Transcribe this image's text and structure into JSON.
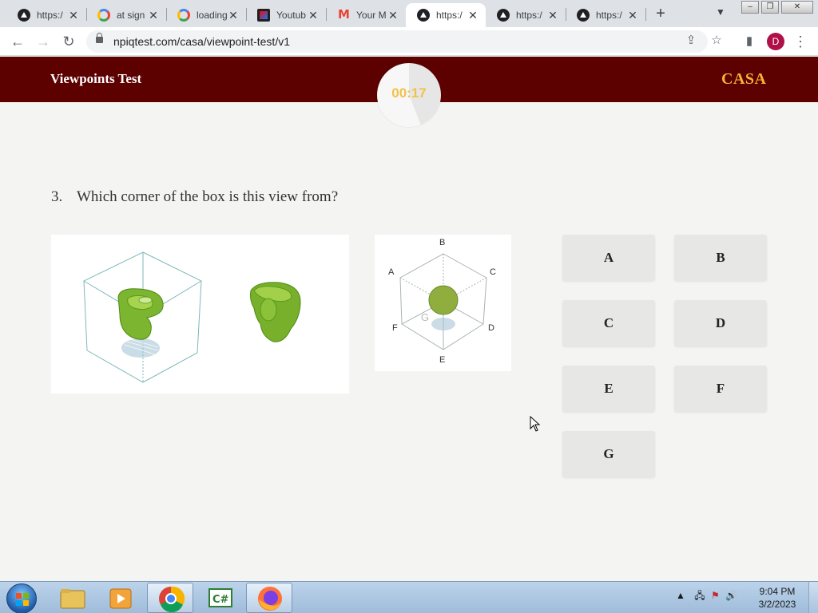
{
  "browser": {
    "tabs": [
      {
        "title": "https:/",
        "icon": "vercel-icon"
      },
      {
        "title": "at sign",
        "icon": "google-icon"
      },
      {
        "title": "loading",
        "icon": "google-icon"
      },
      {
        "title": "Youtub",
        "icon": "youtube-studio-icon"
      },
      {
        "title": "Your M",
        "icon": "gmail-icon"
      },
      {
        "title": "https:/",
        "icon": "vercel-icon",
        "active": true
      },
      {
        "title": "https:/",
        "icon": "vercel-icon"
      },
      {
        "title": "https:/",
        "icon": "vercel-icon"
      }
    ],
    "url": "npiqtest.com/casa/viewpoint-test/v1",
    "profile_initial": "D"
  },
  "site": {
    "title": "Viewpoints Test",
    "brand": "CASA",
    "brand_color": "#f5b335",
    "header_color": "#5c0000",
    "timer": "00:17",
    "timer_progress_percent": 44
  },
  "question": {
    "number": "3.",
    "text": "Which corner of the box is this view from?",
    "corner_labels": {
      "top": "B",
      "upper_left": "A",
      "upper_right": "C",
      "lower_left": "F",
      "lower_right": "D",
      "bottom": "E",
      "center": "G"
    }
  },
  "answers": [
    "A",
    "B",
    "C",
    "D",
    "E",
    "F",
    "G"
  ],
  "taskbar": {
    "time": "9:04 PM",
    "date": "3/2/2023"
  }
}
